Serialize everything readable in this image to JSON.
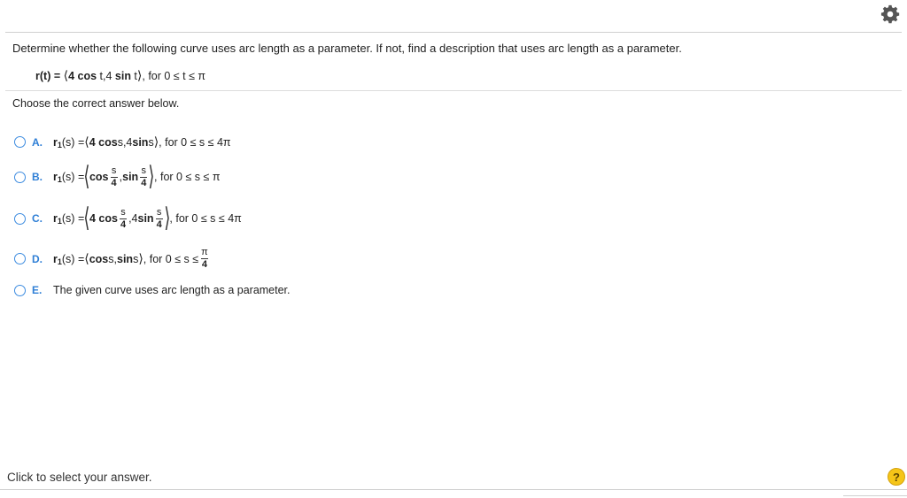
{
  "header": {
    "settings_icon": "gear-icon"
  },
  "question": {
    "prompt": "Determine whether the following curve uses arc length as a parameter. If not, find a description that uses arc length as a parameter.",
    "given": {
      "lhs": "r(t) = ",
      "open": "⟨",
      "expr1": "4 cos",
      "t1": " t,4 ",
      "expr2": "sin",
      "t2": " t",
      "close": "⟩",
      "domain": ", for 0 ≤ t ≤ π"
    },
    "instruction": "Choose the correct answer below."
  },
  "options": [
    {
      "letter": "A.",
      "r": "r",
      "sub": "1",
      "arg": "(s) = ",
      "body_a": "⟨",
      "b1": "4 cos",
      "m1": " s,4 ",
      "b2": "sin",
      "m2": " s",
      "body_z": "⟩",
      "domain": ", for 0 ≤ s ≤ 4π"
    },
    {
      "letter": "B.",
      "r": "r",
      "sub": "1",
      "arg": "(s) = ",
      "b1": "cos",
      "num1": "s",
      "den1": "4",
      "sep": ", ",
      "b2": "sin",
      "num2": "s",
      "den2": "4",
      "domain": ", for 0 ≤ s ≤ π"
    },
    {
      "letter": "C.",
      "r": "r",
      "sub": "1",
      "arg": "(s) = ",
      "b1": "4 cos",
      "num1": "s",
      "den1": "4",
      "sep": ",4 ",
      "b2": "sin",
      "num2": "s",
      "den2": "4",
      "domain": ", for 0 ≤ s ≤ 4π"
    },
    {
      "letter": "D.",
      "r": "r",
      "sub": "1",
      "arg": "(s) = ",
      "body_a": "⟨",
      "b1": "cos",
      "m1": " s, ",
      "b2": "sin",
      "m2": " s",
      "body_z": "⟩",
      "domain_pre": ", for 0 ≤ s ≤ ",
      "num": "π",
      "den": "4"
    },
    {
      "letter": "E.",
      "text": "The given curve uses arc length as a parameter."
    }
  ],
  "footer": {
    "status": "Click to select your answer.",
    "help_label": "?"
  },
  "colors": {
    "accent": "#2f7fd6",
    "help": "#f5c518"
  }
}
